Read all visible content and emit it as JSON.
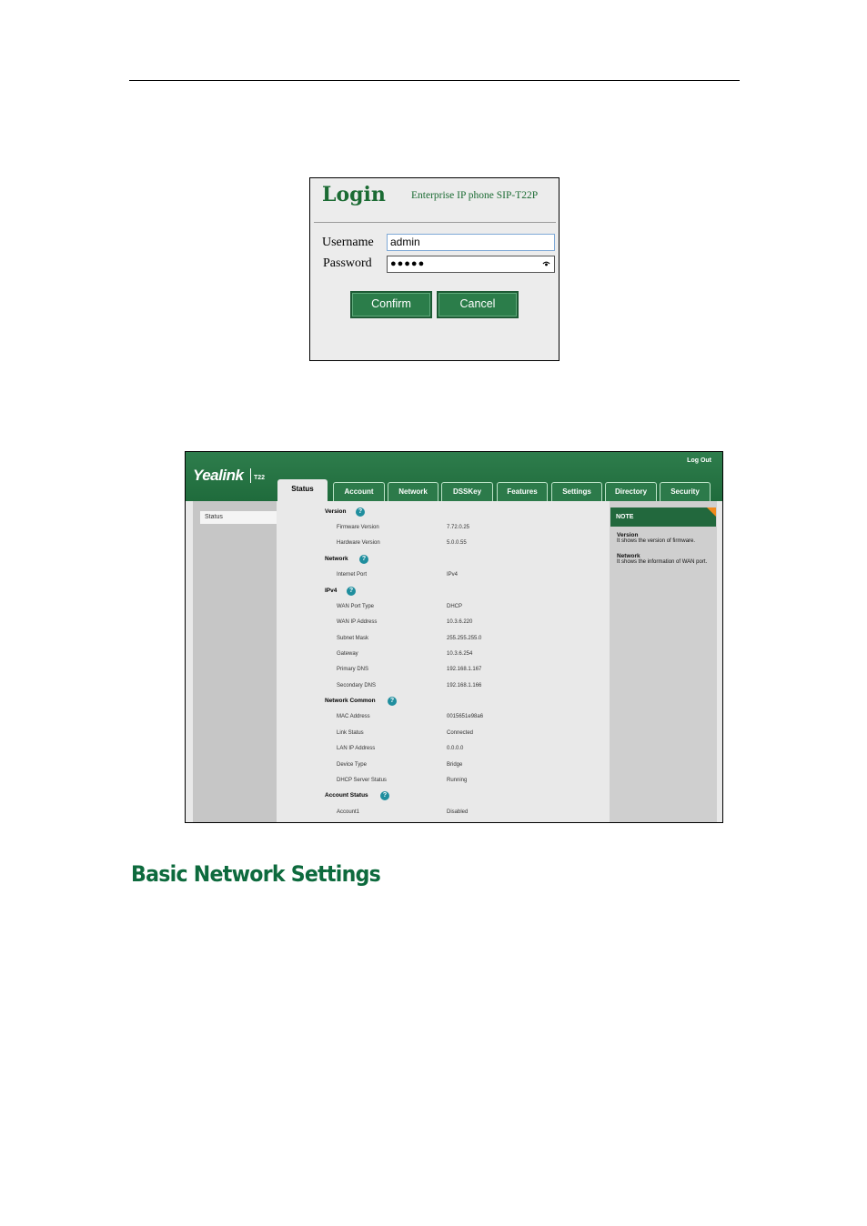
{
  "login": {
    "title": "Login",
    "subtitle": "Enterprise IP phone SIP-T22P",
    "username_label": "Username",
    "username_value": "admin",
    "password_label": "Password",
    "password_value": "●●●●●",
    "confirm_label": "Confirm",
    "cancel_label": "Cancel"
  },
  "webui": {
    "logo": "Yealink",
    "model": "T22",
    "logout": "Log Out",
    "tabs": [
      "Status",
      "Account",
      "Network",
      "DSSKey",
      "Features",
      "Settings",
      "Directory",
      "Security"
    ],
    "active_tab": "Status",
    "sidebar_items": [
      "Status"
    ],
    "sections": {
      "version": {
        "title": "Version",
        "rows": [
          {
            "label": "Firmware Version",
            "value": "7.72.0.25"
          },
          {
            "label": "Hardware Version",
            "value": "5.0.0.55"
          }
        ]
      },
      "network": {
        "title": "Network",
        "rows": [
          {
            "label": "Internet Port",
            "value": "IPv4"
          }
        ]
      },
      "ipv4": {
        "title": "IPv4",
        "rows": [
          {
            "label": "WAN Port Type",
            "value": "DHCP"
          },
          {
            "label": "WAN IP Address",
            "value": "10.3.6.220"
          },
          {
            "label": "Subnet Mask",
            "value": "255.255.255.0"
          },
          {
            "label": "Gateway",
            "value": "10.3.6.254"
          },
          {
            "label": "Primary DNS",
            "value": "192.168.1.167"
          },
          {
            "label": "Secondary DNS",
            "value": "192.168.1.166"
          }
        ]
      },
      "network_common": {
        "title": "Network Common",
        "rows": [
          {
            "label": "MAC Address",
            "value": "0015651e98a6"
          },
          {
            "label": "Link Status",
            "value": "Connected"
          },
          {
            "label": "LAN IP Address",
            "value": "0.0.0.0"
          },
          {
            "label": "Device Type",
            "value": "Bridge"
          },
          {
            "label": "DHCP Server Status",
            "value": "Running"
          }
        ]
      },
      "account_status": {
        "title": "Account Status",
        "rows": [
          {
            "label": "Account1",
            "value": "Disabled"
          }
        ]
      }
    },
    "help_glyph": "?",
    "note": {
      "header": "NOTE",
      "items": [
        {
          "title": "Version",
          "text": "It shows the version of firmware."
        },
        {
          "title": "Network",
          "text": "It shows the information of WAN port."
        }
      ]
    },
    "accent_color": "#1f6b3c"
  },
  "section_heading": "Basic Network Settings"
}
